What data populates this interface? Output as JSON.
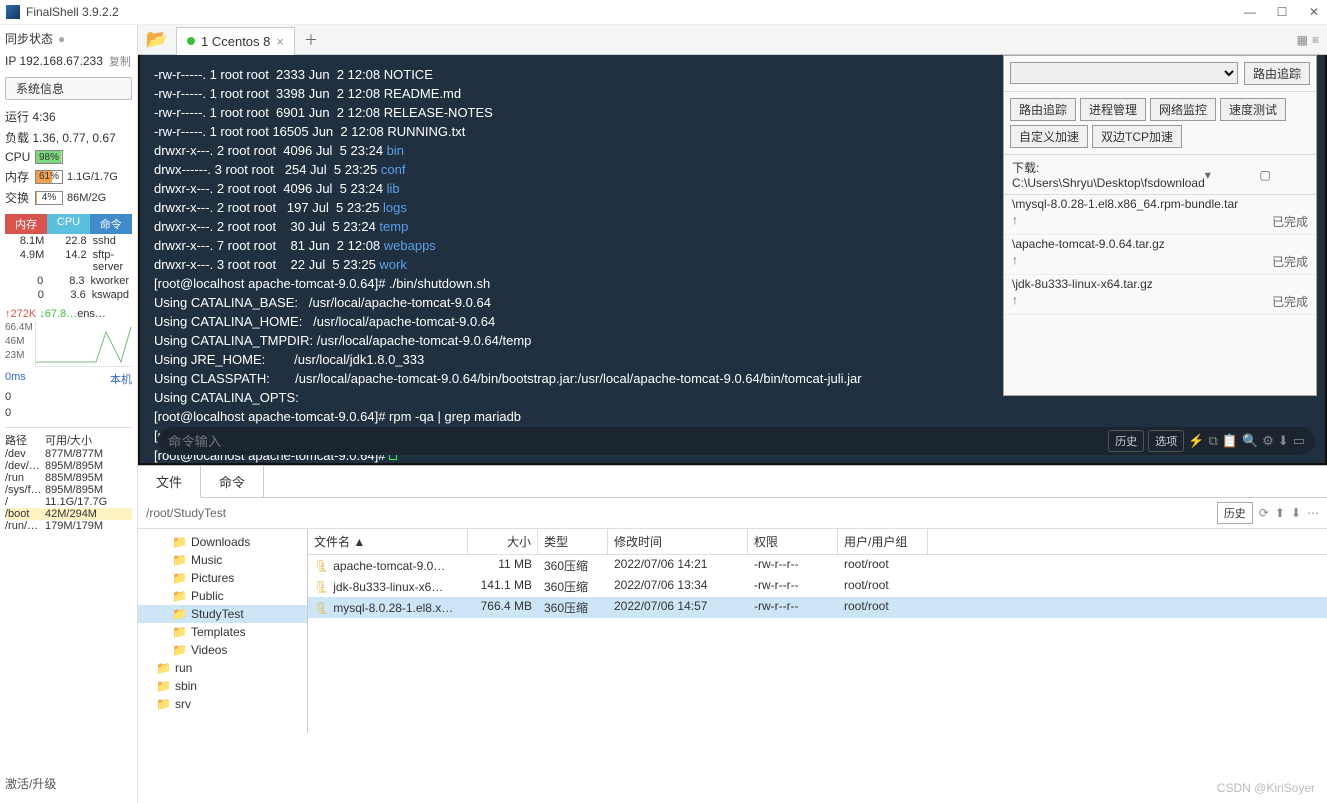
{
  "app": {
    "title": "FinalShell 3.9.2.2"
  },
  "sidebar": {
    "syncLabel": "同步状态",
    "ip": "IP 192.168.67.233",
    "copy": "复制",
    "sysInfoBtn": "系统信息",
    "uptime": "运行 4:36",
    "load": "负载 1.36, 0.77, 0.67",
    "cpuLabel": "CPU",
    "cpuPct": "98%",
    "memLabel": "内存",
    "memPct": "61%",
    "memVal": "1.1G/1.7G",
    "swapLabel": "交换",
    "swapPct": "4%",
    "swapVal": "86M/2G",
    "procHead": [
      "内存",
      "CPU",
      "命令"
    ],
    "procs": [
      [
        "8.1M",
        "22.8",
        "sshd"
      ],
      [
        "4.9M",
        "14.2",
        "sftp-server"
      ],
      [
        "0",
        "8.3",
        "kworker"
      ],
      [
        "0",
        "3.6",
        "kswapd"
      ]
    ],
    "net": {
      "up": "↑272K",
      "down": "↓67.8…",
      "iface": "ens…",
      "y1": "66.4M",
      "y2": "46M",
      "y3": "23M"
    },
    "msLabel": "0ms",
    "localLabel": "本机",
    "zeros": [
      "0",
      "0"
    ],
    "diskHead": [
      "路径",
      "可用/大小"
    ],
    "disks": [
      [
        "/dev",
        "877M/877M"
      ],
      [
        "/dev/…",
        "895M/895M"
      ],
      [
        "/run",
        "885M/895M"
      ],
      [
        "/sys/f…",
        "895M/895M"
      ],
      [
        "/",
        "11.1G/17.7G"
      ],
      [
        "/boot",
        "42M/294M"
      ],
      [
        "/run/…",
        "179M/179M"
      ]
    ],
    "activate": "激活/升级"
  },
  "tab": {
    "label": "1 Ccentos 8"
  },
  "terminal": {
    "lines": [
      {
        "p": "-rw-r-----. 1 root root  2333 Jun  2 12:08 NOTICE"
      },
      {
        "p": "-rw-r-----. 1 root root  3398 Jun  2 12:08 README.md"
      },
      {
        "p": "-rw-r-----. 1 root root  6901 Jun  2 12:08 RELEASE-NOTES"
      },
      {
        "p": "-rw-r-----. 1 root root 16505 Jun  2 12:08 RUNNING.txt"
      },
      {
        "p": "drwxr-x---. 2 root root  4096 Jul  5 23:24 ",
        "d": "bin"
      },
      {
        "p": "drwx------. 3 root root   254 Jul  5 23:25 ",
        "d": "conf"
      },
      {
        "p": "drwxr-x---. 2 root root  4096 Jul  5 23:24 ",
        "d": "lib"
      },
      {
        "p": "drwxr-x---. 2 root root   197 Jul  5 23:25 ",
        "d": "logs"
      },
      {
        "p": "drwxr-x---. 2 root root    30 Jul  5 23:24 ",
        "d": "temp"
      },
      {
        "p": "drwxr-x---. 7 root root    81 Jun  2 12:08 ",
        "d": "webapps"
      },
      {
        "p": "drwxr-x---. 3 root root    22 Jul  5 23:25 ",
        "d": "work"
      },
      {
        "p": "[root@localhost apache-tomcat-9.0.64]# ./bin/shutdown.sh"
      },
      {
        "p": "Using CATALINA_BASE:   /usr/local/apache-tomcat-9.0.64"
      },
      {
        "p": "Using CATALINA_HOME:   /usr/local/apache-tomcat-9.0.64"
      },
      {
        "p": "Using CATALINA_TMPDIR: /usr/local/apache-tomcat-9.0.64/temp"
      },
      {
        "p": "Using JRE_HOME:        /usr/local/jdk1.8.0_333"
      },
      {
        "p": "Using CLASSPATH:       /usr/local/apache-tomcat-9.0.64/bin/bootstrap.jar:/usr/local/apache-tomcat-9.0.64/bin/tomcat-juli.jar"
      },
      {
        "p": "Using CATALINA_OPTS:"
      },
      {
        "p": "[root@localhost apache-tomcat-9.0.64]# rpm -qa | grep mariadb"
      },
      {
        "p": "[root@localhost apache-tomcat-9.0.64]# rpm -qa | grep mysql"
      },
      {
        "p": "[root@localhost apache-tomcat-9.0.64]# ",
        "cursor": true
      }
    ],
    "cmdPlaceholder": "命令输入",
    "btnHistory": "历史",
    "btnOptions": "选项"
  },
  "overlay": {
    "traceBtn": "路由追踪",
    "tabs": [
      "路由追踪",
      "进程管理",
      "网络监控",
      "速度测试",
      "自定义加速",
      "双边TCP加速"
    ],
    "dlLabel": "下载:",
    "dlPath": "C:\\Users\\Shryu\\Desktop\\fsdownload",
    "items": [
      {
        "name": "\\mysql-8.0.28-1.el8.x86_64.rpm-bundle.tar",
        "status": "已完成",
        "up": "↑"
      },
      {
        "name": "\\apache-tomcat-9.0.64.tar.gz",
        "status": "已完成",
        "up": "↑"
      },
      {
        "name": "\\jdk-8u333-linux-x64.tar.gz",
        "status": "已完成",
        "up": "↑"
      }
    ]
  },
  "files": {
    "tabFile": "文件",
    "tabCmd": "命令",
    "path": "/root/StudyTest",
    "historyBtn": "历史",
    "col": [
      "文件名",
      "大小",
      "类型",
      "修改时间",
      "权限",
      "用户/用户组"
    ],
    "tree": [
      {
        "lvl": "l2",
        "name": "Downloads"
      },
      {
        "lvl": "l2",
        "name": "Music"
      },
      {
        "lvl": "l2",
        "name": "Pictures"
      },
      {
        "lvl": "l2",
        "name": "Public"
      },
      {
        "lvl": "l2",
        "name": "StudyTest",
        "sel": true
      },
      {
        "lvl": "l2",
        "name": "Templates"
      },
      {
        "lvl": "l2",
        "name": "Videos"
      },
      {
        "lvl": "l1",
        "name": "run"
      },
      {
        "lvl": "l1",
        "name": "sbin"
      },
      {
        "lvl": "l1",
        "name": "srv"
      }
    ],
    "rows": [
      {
        "n": "apache-tomcat-9.0…",
        "s": "11 MB",
        "t": "360压缩",
        "m": "2022/07/06 14:21",
        "p": "-rw-r--r--",
        "u": "root/root"
      },
      {
        "n": "jdk-8u333-linux-x6…",
        "s": "141.1 MB",
        "t": "360压缩",
        "m": "2022/07/06 13:34",
        "p": "-rw-r--r--",
        "u": "root/root"
      },
      {
        "n": "mysql-8.0.28-1.el8.x…",
        "s": "766.4 MB",
        "t": "360压缩",
        "m": "2022/07/06 14:57",
        "p": "-rw-r--r--",
        "u": "root/root",
        "sel": true
      }
    ]
  },
  "watermark": "CSDN @KiriSoyer"
}
